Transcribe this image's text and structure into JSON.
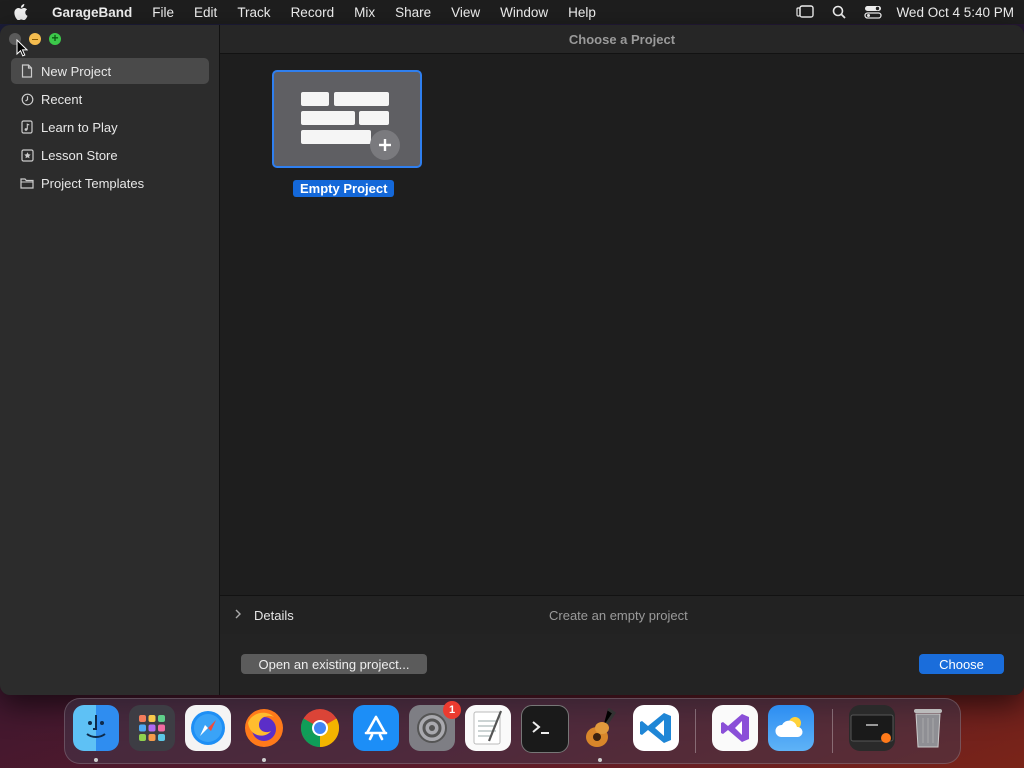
{
  "menubar": {
    "app_name": "GarageBand",
    "items": [
      "File",
      "Edit",
      "Track",
      "Record",
      "Mix",
      "Share",
      "View",
      "Window",
      "Help"
    ],
    "clock": "Wed Oct 4  5:40 PM"
  },
  "window": {
    "title": "Choose a Project",
    "sidebar": {
      "items": [
        {
          "label": "New Project",
          "icon": "document-icon",
          "selected": true
        },
        {
          "label": "Recent",
          "icon": "clock-icon"
        },
        {
          "label": "Learn to Play",
          "icon": "music-note-icon"
        },
        {
          "label": "Lesson Store",
          "icon": "star-box-icon"
        },
        {
          "label": "Project Templates",
          "icon": "folder-icon"
        }
      ]
    },
    "tile": {
      "label": "Empty Project"
    },
    "details": {
      "label": "Details",
      "description": "Create an empty project"
    },
    "footer": {
      "open_label": "Open an existing project...",
      "choose_label": "Choose"
    }
  },
  "dock": {
    "apps": [
      "Finder",
      "Launchpad",
      "Safari",
      "Firefox",
      "Chrome",
      "App Store",
      "System Settings",
      "TextEdit",
      "Terminal",
      "GarageBand",
      "Visual Studio Code",
      "Visual Studio",
      "Weather",
      "Recent Window",
      "Trash"
    ],
    "system_settings_badge": "1"
  },
  "colors": {
    "accent": "#1a6ddb",
    "selection": "#2f7fef"
  }
}
